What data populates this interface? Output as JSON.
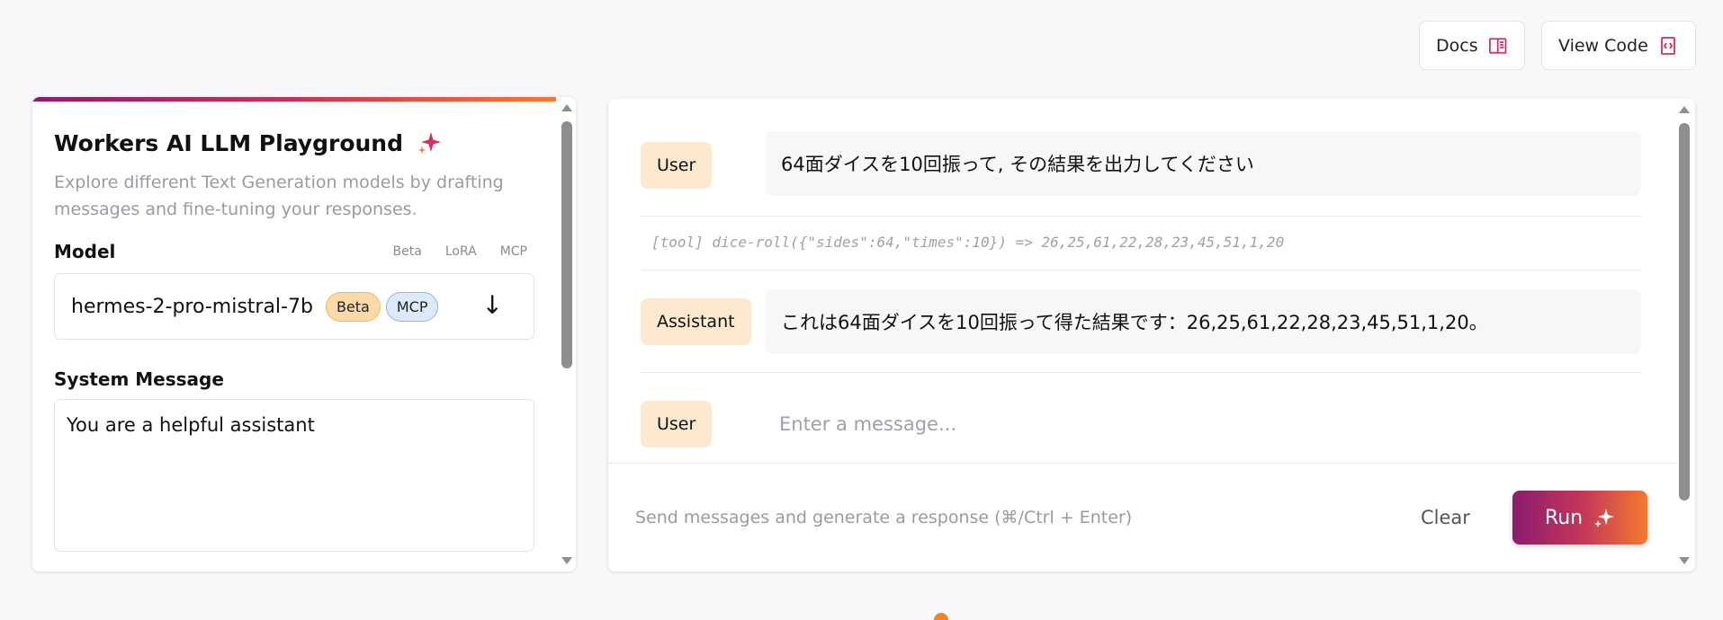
{
  "header": {
    "docs_label": "Docs",
    "view_code_label": "View Code"
  },
  "left_panel": {
    "title": "Workers AI LLM Playground",
    "description": "Explore different Text Generation models by drafting messages and fine-tuning your responses.",
    "model_label": "Model",
    "model_tags": [
      "Beta",
      "LoRA",
      "MCP"
    ],
    "selected_model": "hermes-2-pro-mistral-7b",
    "model_badges": [
      "Beta",
      "MCP"
    ],
    "system_message_label": "System Message",
    "system_message_value": "You are a helpful assistant"
  },
  "chat": {
    "messages": [
      {
        "role": "User",
        "text": "64面ダイスを10回振って, その結果を出力してください"
      },
      {
        "role": "Assistant",
        "text": "これは64面ダイスを10回振って得た結果です：26,25,61,22,28,23,45,51,1,20。"
      }
    ],
    "tool_call": "[tool] dice-roll({\"sides\":64,\"times\":10}) => 26,25,61,22,28,23,45,51,1,20",
    "new_message_role": "User",
    "input_placeholder": "Enter a message...",
    "hint": "Send messages and generate a response (⌘/Ctrl + Enter)",
    "clear_label": "Clear",
    "run_label": "Run"
  },
  "colors": {
    "accent_gradient_start": "#8b1c6e",
    "accent_gradient_end": "#f47a2e",
    "role_badge_bg": "#fde9cf"
  }
}
